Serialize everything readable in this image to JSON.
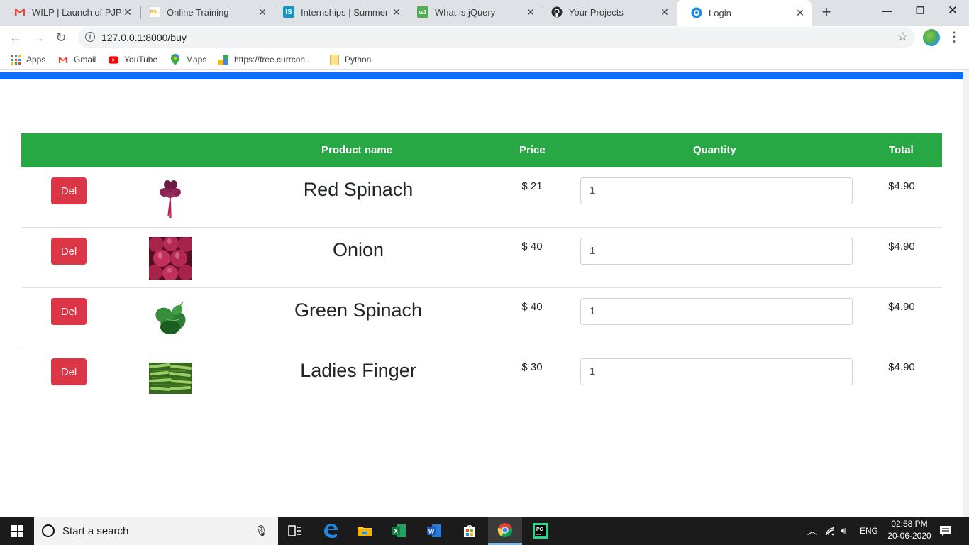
{
  "browser": {
    "tabs": [
      {
        "title": "WILP | Launch of PJP - s",
        "favicon": "gmail-icon",
        "color": "#ea4335"
      },
      {
        "title": "Online Training",
        "favicon": "training-icon",
        "color": "#f5a623"
      },
      {
        "title": "Internships | Summer In",
        "favicon": "internshala-icon",
        "color": "#1295c9"
      },
      {
        "title": "What is jQuery",
        "favicon": "w3schools-icon",
        "color": "#4caf50"
      },
      {
        "title": "Your Projects",
        "favicon": "github-icon",
        "color": "#24292e"
      },
      {
        "title": "Login",
        "favicon": "django-icon",
        "color": "#1e88e5",
        "active": true
      }
    ],
    "url": "127.0.0.1:8000/buy",
    "bookmarks": [
      {
        "label": "Apps"
      },
      {
        "label": "Gmail"
      },
      {
        "label": "YouTube"
      },
      {
        "label": "Maps"
      },
      {
        "label": "https://free.currcon..."
      },
      {
        "label": "Python"
      }
    ]
  },
  "cart": {
    "headers": {
      "product_name": "Product name",
      "price": "Price",
      "quantity": "Quantity",
      "total": "Total"
    },
    "del_label": "Del",
    "items": [
      {
        "name": "Red Spinach",
        "price": "$ 21",
        "quantity": "1",
        "total": "$4.90",
        "image": "red-spinach-image"
      },
      {
        "name": "Onion",
        "price": "$ 40",
        "quantity": "1",
        "total": "$4.90",
        "image": "onion-image"
      },
      {
        "name": "Green Spinach",
        "price": "$ 40",
        "quantity": "1",
        "total": "$4.90",
        "image": "green-spinach-image"
      },
      {
        "name": "Ladies Finger",
        "price": "$ 30",
        "quantity": "1",
        "total": "$4.90",
        "image": "ladies-finger-image"
      }
    ]
  },
  "taskbar": {
    "search_placeholder": "Start a search",
    "language": "ENG",
    "time": "02:58 PM",
    "date": "20-06-2020"
  },
  "colors": {
    "header_green": "#28a745",
    "delete_red": "#dc3545",
    "top_bar_blue": "#0d6efd"
  }
}
